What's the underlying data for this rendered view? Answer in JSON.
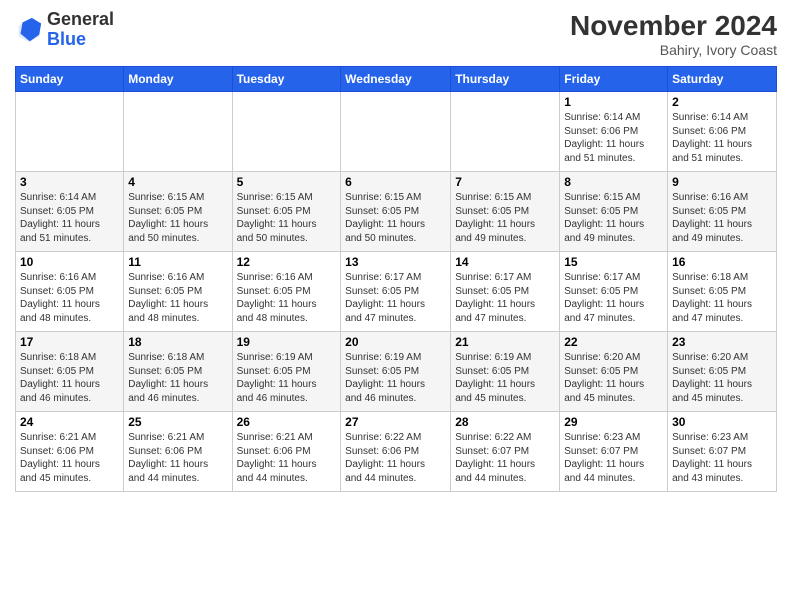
{
  "logo": {
    "general": "General",
    "blue": "Blue"
  },
  "header": {
    "month": "November 2024",
    "location": "Bahiry, Ivory Coast"
  },
  "weekdays": [
    "Sunday",
    "Monday",
    "Tuesday",
    "Wednesday",
    "Thursday",
    "Friday",
    "Saturday"
  ],
  "weeks": [
    [
      {
        "day": "",
        "info": ""
      },
      {
        "day": "",
        "info": ""
      },
      {
        "day": "",
        "info": ""
      },
      {
        "day": "",
        "info": ""
      },
      {
        "day": "",
        "info": ""
      },
      {
        "day": "1",
        "info": "Sunrise: 6:14 AM\nSunset: 6:06 PM\nDaylight: 11 hours\nand 51 minutes."
      },
      {
        "day": "2",
        "info": "Sunrise: 6:14 AM\nSunset: 6:06 PM\nDaylight: 11 hours\nand 51 minutes."
      }
    ],
    [
      {
        "day": "3",
        "info": "Sunrise: 6:14 AM\nSunset: 6:05 PM\nDaylight: 11 hours\nand 51 minutes."
      },
      {
        "day": "4",
        "info": "Sunrise: 6:15 AM\nSunset: 6:05 PM\nDaylight: 11 hours\nand 50 minutes."
      },
      {
        "day": "5",
        "info": "Sunrise: 6:15 AM\nSunset: 6:05 PM\nDaylight: 11 hours\nand 50 minutes."
      },
      {
        "day": "6",
        "info": "Sunrise: 6:15 AM\nSunset: 6:05 PM\nDaylight: 11 hours\nand 50 minutes."
      },
      {
        "day": "7",
        "info": "Sunrise: 6:15 AM\nSunset: 6:05 PM\nDaylight: 11 hours\nand 49 minutes."
      },
      {
        "day": "8",
        "info": "Sunrise: 6:15 AM\nSunset: 6:05 PM\nDaylight: 11 hours\nand 49 minutes."
      },
      {
        "day": "9",
        "info": "Sunrise: 6:16 AM\nSunset: 6:05 PM\nDaylight: 11 hours\nand 49 minutes."
      }
    ],
    [
      {
        "day": "10",
        "info": "Sunrise: 6:16 AM\nSunset: 6:05 PM\nDaylight: 11 hours\nand 48 minutes."
      },
      {
        "day": "11",
        "info": "Sunrise: 6:16 AM\nSunset: 6:05 PM\nDaylight: 11 hours\nand 48 minutes."
      },
      {
        "day": "12",
        "info": "Sunrise: 6:16 AM\nSunset: 6:05 PM\nDaylight: 11 hours\nand 48 minutes."
      },
      {
        "day": "13",
        "info": "Sunrise: 6:17 AM\nSunset: 6:05 PM\nDaylight: 11 hours\nand 47 minutes."
      },
      {
        "day": "14",
        "info": "Sunrise: 6:17 AM\nSunset: 6:05 PM\nDaylight: 11 hours\nand 47 minutes."
      },
      {
        "day": "15",
        "info": "Sunrise: 6:17 AM\nSunset: 6:05 PM\nDaylight: 11 hours\nand 47 minutes."
      },
      {
        "day": "16",
        "info": "Sunrise: 6:18 AM\nSunset: 6:05 PM\nDaylight: 11 hours\nand 47 minutes."
      }
    ],
    [
      {
        "day": "17",
        "info": "Sunrise: 6:18 AM\nSunset: 6:05 PM\nDaylight: 11 hours\nand 46 minutes."
      },
      {
        "day": "18",
        "info": "Sunrise: 6:18 AM\nSunset: 6:05 PM\nDaylight: 11 hours\nand 46 minutes."
      },
      {
        "day": "19",
        "info": "Sunrise: 6:19 AM\nSunset: 6:05 PM\nDaylight: 11 hours\nand 46 minutes."
      },
      {
        "day": "20",
        "info": "Sunrise: 6:19 AM\nSunset: 6:05 PM\nDaylight: 11 hours\nand 46 minutes."
      },
      {
        "day": "21",
        "info": "Sunrise: 6:19 AM\nSunset: 6:05 PM\nDaylight: 11 hours\nand 45 minutes."
      },
      {
        "day": "22",
        "info": "Sunrise: 6:20 AM\nSunset: 6:05 PM\nDaylight: 11 hours\nand 45 minutes."
      },
      {
        "day": "23",
        "info": "Sunrise: 6:20 AM\nSunset: 6:05 PM\nDaylight: 11 hours\nand 45 minutes."
      }
    ],
    [
      {
        "day": "24",
        "info": "Sunrise: 6:21 AM\nSunset: 6:06 PM\nDaylight: 11 hours\nand 45 minutes."
      },
      {
        "day": "25",
        "info": "Sunrise: 6:21 AM\nSunset: 6:06 PM\nDaylight: 11 hours\nand 44 minutes."
      },
      {
        "day": "26",
        "info": "Sunrise: 6:21 AM\nSunset: 6:06 PM\nDaylight: 11 hours\nand 44 minutes."
      },
      {
        "day": "27",
        "info": "Sunrise: 6:22 AM\nSunset: 6:06 PM\nDaylight: 11 hours\nand 44 minutes."
      },
      {
        "day": "28",
        "info": "Sunrise: 6:22 AM\nSunset: 6:07 PM\nDaylight: 11 hours\nand 44 minutes."
      },
      {
        "day": "29",
        "info": "Sunrise: 6:23 AM\nSunset: 6:07 PM\nDaylight: 11 hours\nand 44 minutes."
      },
      {
        "day": "30",
        "info": "Sunrise: 6:23 AM\nSunset: 6:07 PM\nDaylight: 11 hours\nand 43 minutes."
      }
    ]
  ]
}
